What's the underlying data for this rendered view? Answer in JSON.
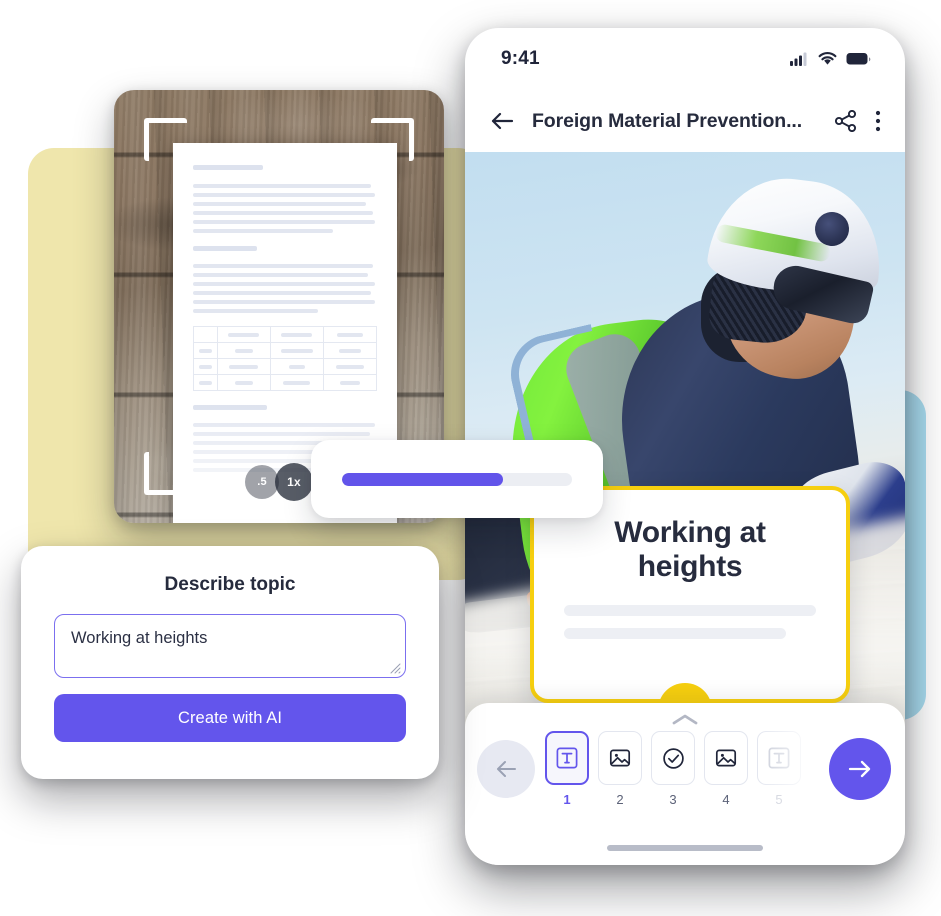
{
  "backdrops": {
    "yellow_color": "#efe6ac",
    "blue_color": "#a9dcef"
  },
  "scanner": {
    "name": "document-scanner-preview",
    "brackets": [
      "top-left",
      "top-right",
      "bottom-left",
      "bottom-right"
    ],
    "zoom_levels": [
      {
        "label": ".5",
        "active": false
      },
      {
        "label": "1x",
        "active": true
      }
    ],
    "page_skeleton": {
      "table_columns": 4,
      "table_rows": 4
    }
  },
  "progress_card": {
    "name": "generation-progress",
    "percent": 70,
    "fill_color": "#6254ea",
    "track_color": "#eceef3"
  },
  "describe_panel": {
    "title": "Describe topic",
    "input": {
      "value": "Working at heights",
      "placeholder": "Describe topic"
    },
    "submit_label": "Create with AI",
    "accent_color": "#6355ec"
  },
  "phone": {
    "status_bar": {
      "time": "9:41",
      "icons": [
        "cellular-signal-icon",
        "wifi-icon",
        "battery-icon"
      ]
    },
    "app_bar": {
      "back_icon": "arrow-left-icon",
      "title": "Foreign Material Prevention...",
      "share_icon": "share-icon",
      "overflow_icon": "more-vertical-icon"
    },
    "hero": {
      "alt": "Worker in white hard hat, sunglasses and hi-vis vest working at height",
      "card": {
        "heading": "Working at heights",
        "border_color": "#f6cf0f",
        "skeleton_lines": 2
      },
      "fab": {
        "icon": "chevron-down-icon",
        "color": "#f6cf0f"
      }
    },
    "bottom_sheet": {
      "expand_icon": "chevron-up-icon",
      "prev_label": "arrow-left-icon",
      "next_label": "arrow-right-icon",
      "steps": [
        {
          "num": "1",
          "icon": "text-block-icon",
          "active": true,
          "faded": false
        },
        {
          "num": "2",
          "icon": "image-icon",
          "active": false,
          "faded": false
        },
        {
          "num": "3",
          "icon": "check-circle-icon",
          "active": false,
          "faded": false
        },
        {
          "num": "4",
          "icon": "image-icon",
          "active": false,
          "faded": false
        },
        {
          "num": "5",
          "icon": "text-block-icon",
          "active": false,
          "faded": true
        }
      ]
    }
  }
}
